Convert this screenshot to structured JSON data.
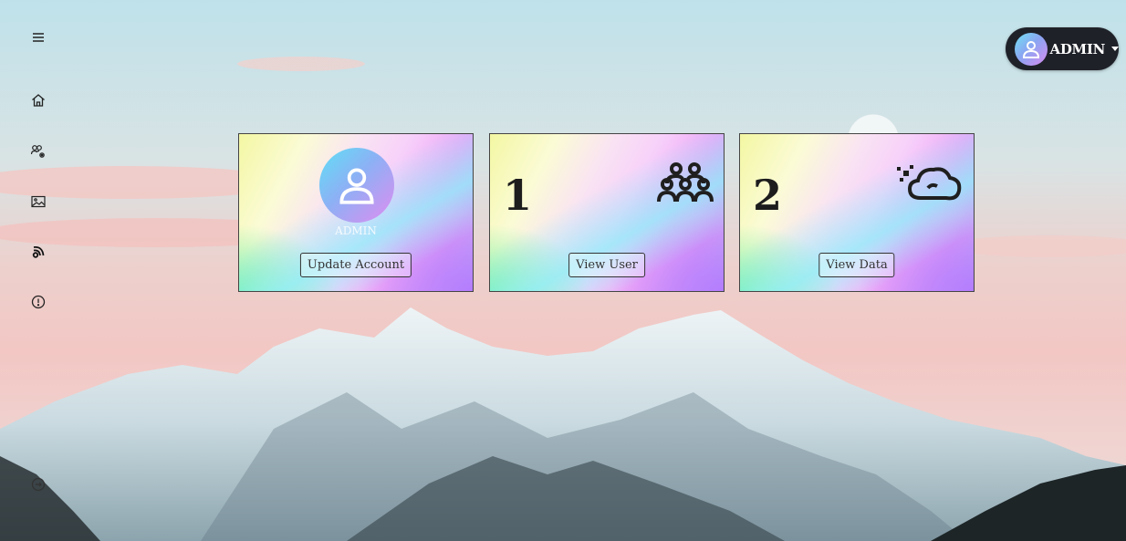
{
  "user_menu": {
    "name": "ADMIN",
    "avatar_icon": "user-circle-icon"
  },
  "sidebar": {
    "items": [
      {
        "name": "menu",
        "icon": "menu-icon"
      },
      {
        "name": "home",
        "icon": "home-icon"
      },
      {
        "name": "users",
        "icon": "users-gear-icon"
      },
      {
        "name": "gallery",
        "icon": "image-icon"
      },
      {
        "name": "data",
        "icon": "signal-icon"
      },
      {
        "name": "info",
        "icon": "info-icon"
      },
      {
        "name": "logout",
        "icon": "logout-icon"
      }
    ]
  },
  "cards": {
    "account": {
      "caption": "ADMIN",
      "button": "Update Account",
      "icon": "user-circle-icon"
    },
    "users": {
      "count": "1",
      "button": "View User",
      "icon": "users-group-icon"
    },
    "data": {
      "count": "2",
      "button": "View Data",
      "icon": "cloud-data-icon"
    }
  },
  "colors": {
    "card_border": "#444444",
    "user_menu_bg": "#1f2129",
    "button_text": "#333333"
  }
}
